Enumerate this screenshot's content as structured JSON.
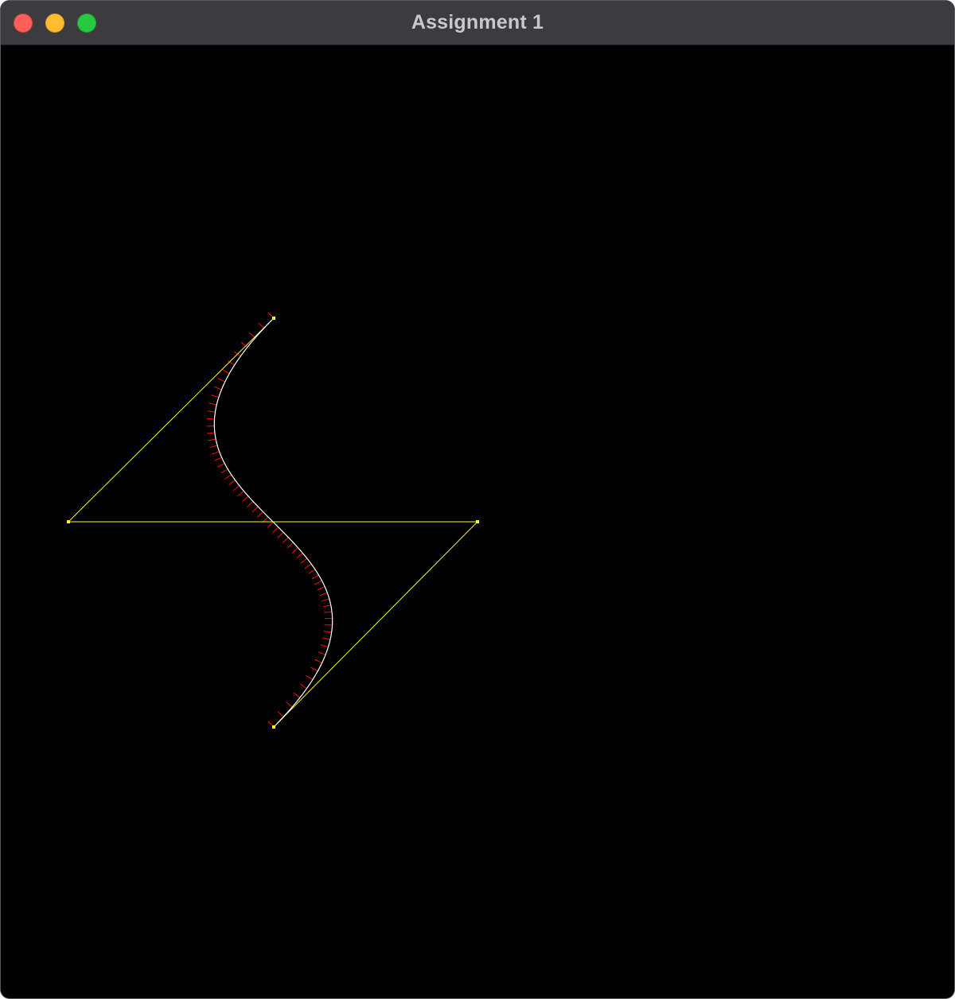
{
  "window": {
    "title": "Assignment 1",
    "buttons": {
      "close_color": "#fe5f57",
      "minimize_color": "#febc2e",
      "zoom_color": "#28c840"
    }
  },
  "scene": {
    "background_color": "#000000",
    "control_polygon_color": "#ffff00",
    "curve_color": "#ffffff",
    "normal_color": "#ff0000",
    "curve_type": "cubic-bezier",
    "normal_count": 60
  }
}
